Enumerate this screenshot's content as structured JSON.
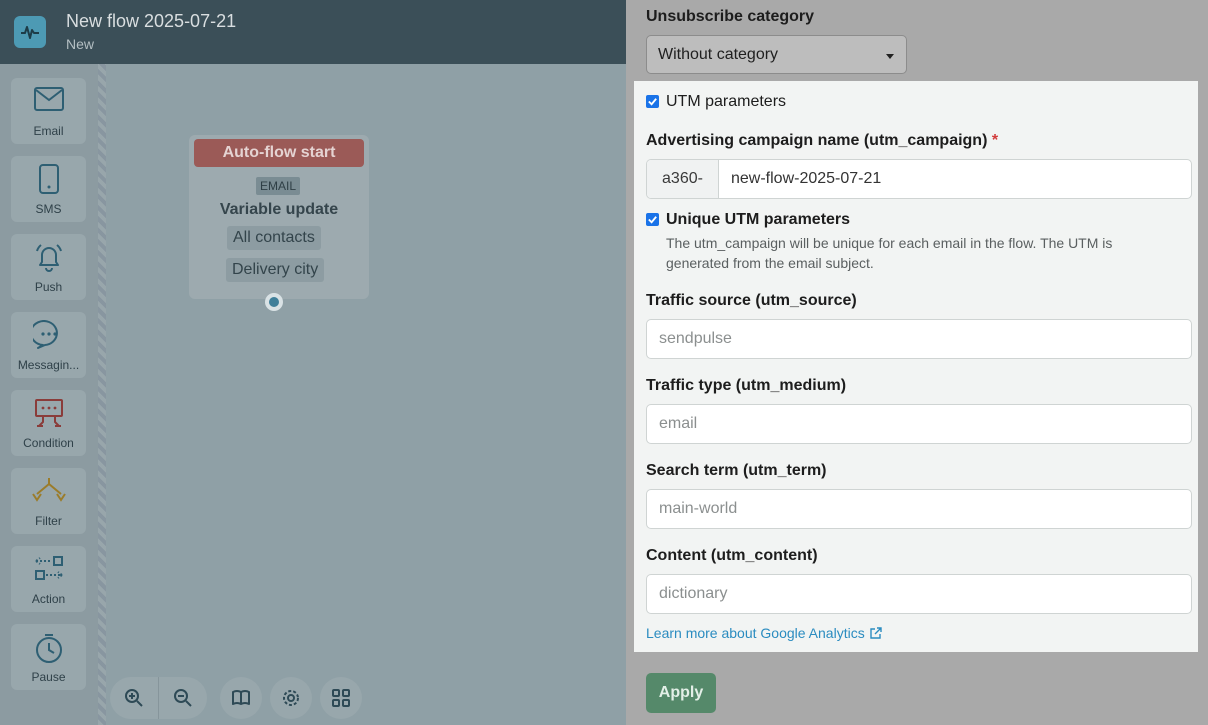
{
  "header": {
    "title": "New flow 2025-07-21",
    "status": "New"
  },
  "tools": [
    {
      "label": "Email",
      "icon": "envelope-icon"
    },
    {
      "label": "SMS",
      "icon": "phone-icon"
    },
    {
      "label": "Push",
      "icon": "bell-icon"
    },
    {
      "label": "Messagin...",
      "icon": "chat-bubble-icon"
    },
    {
      "label": "Condition",
      "icon": "condition-icon"
    },
    {
      "label": "Filter",
      "icon": "filter-icon"
    },
    {
      "label": "Action",
      "icon": "action-icon"
    },
    {
      "label": "Pause",
      "icon": "clock-icon"
    }
  ],
  "node": {
    "header": "Auto-flow start",
    "tag": "EMAIL",
    "title": "Variable update",
    "pill1": "All contacts",
    "pill2": "Delivery city"
  },
  "panel": {
    "unsubscribe_label": "Unsubscribe category",
    "unsubscribe_value": "Without category",
    "utm_checkbox_label": "UTM parameters",
    "campaign_label": "Advertising campaign name (utm_campaign)",
    "required_mark": "*",
    "campaign_prefix": "a360-",
    "campaign_value": "new-flow-2025-07-21",
    "unique_label": "Unique UTM parameters",
    "unique_help": "The utm_campaign will be unique for each email in the flow. The UTM is generated from the email subject.",
    "source_label": "Traffic source (utm_source)",
    "source_placeholder": "sendpulse",
    "medium_label": "Traffic type (utm_medium)",
    "medium_placeholder": "email",
    "term_label": "Search term (utm_term)",
    "term_placeholder": "main-world",
    "content_label": "Content (utm_content)",
    "content_placeholder": "dictionary",
    "learn_more": "Learn more about Google Analytics",
    "apply": "Apply"
  },
  "colors": {
    "accent": "#2b8cc0",
    "apply": "#55896a",
    "flow_start": "#9b5a57"
  }
}
